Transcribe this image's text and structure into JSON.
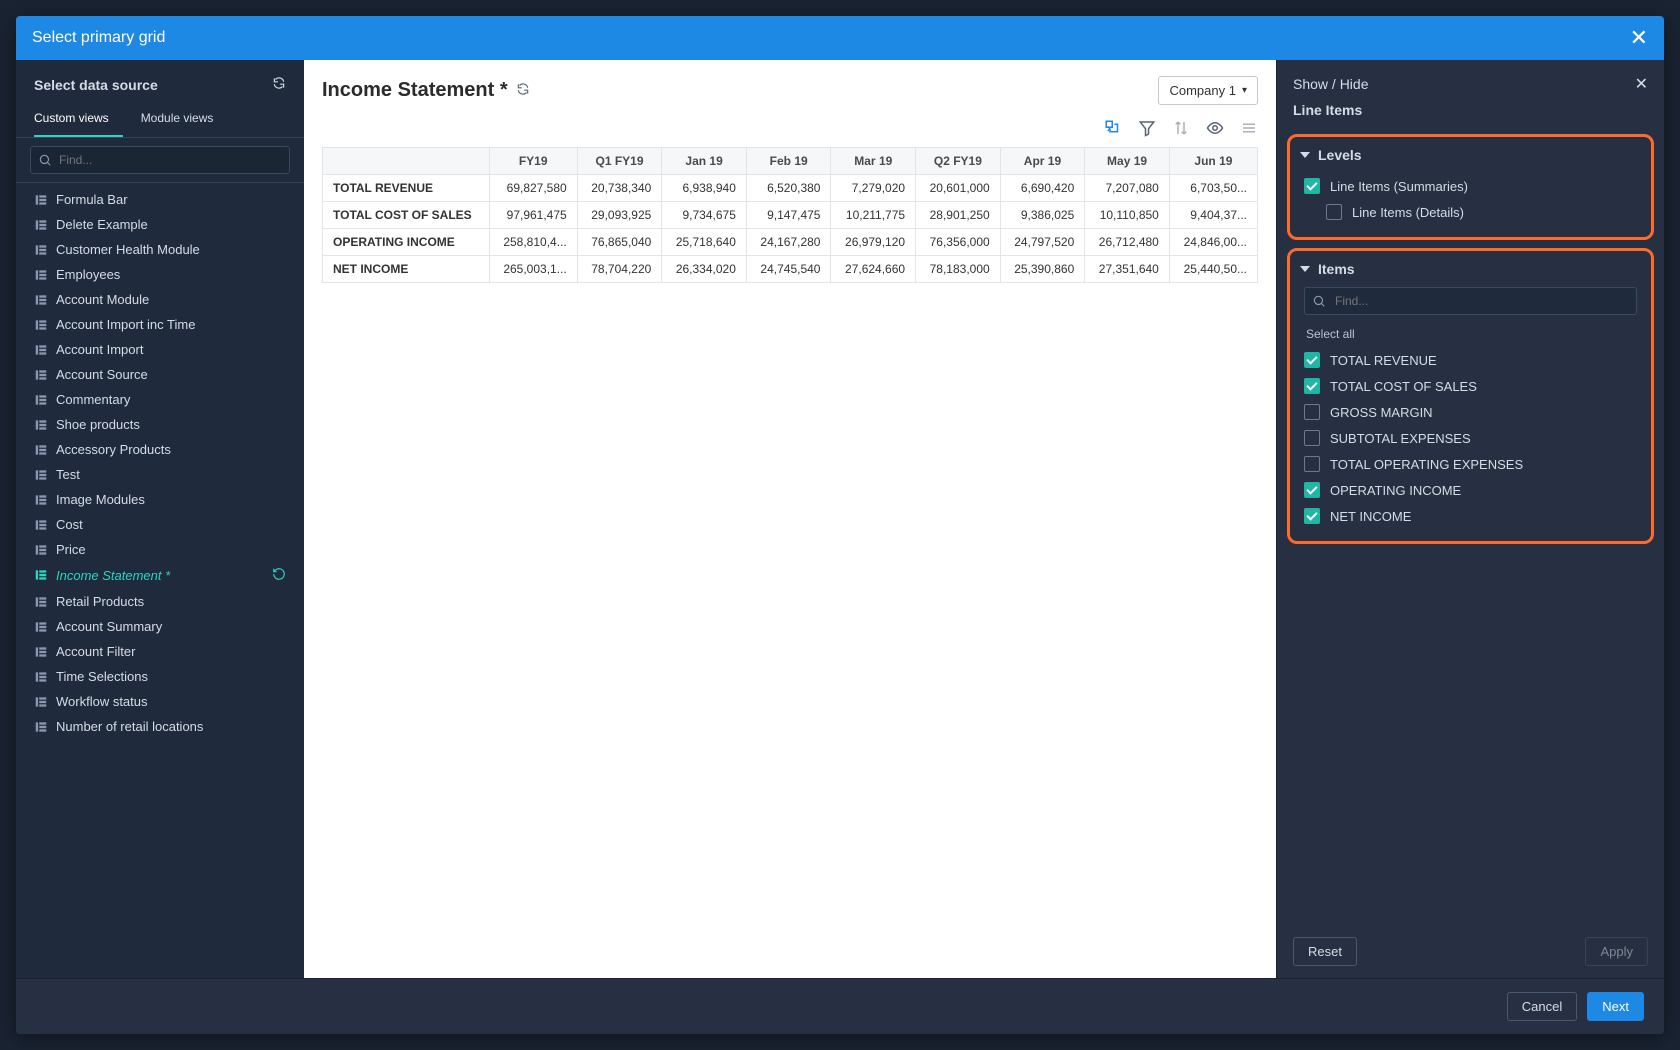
{
  "modal": {
    "title": "Select primary grid",
    "close": "✕"
  },
  "sidebar": {
    "header": "Select data source",
    "tabs": {
      "custom": "Custom views",
      "module": "Module views"
    },
    "search_placeholder": "Find...",
    "active_index": 15,
    "items": [
      "Formula Bar",
      "Delete Example",
      "Customer Health Module",
      "Employees",
      "Account Module",
      "Account Import inc Time",
      "Account Import",
      "Account Source",
      "Commentary",
      "Shoe products",
      "Accessory Products",
      "Test",
      "Image Modules",
      "Cost",
      "Price",
      "Income Statement *",
      "Retail Products",
      "Account Summary",
      "Account Filter",
      "Time Selections",
      "Workflow status",
      "Number of retail locations"
    ]
  },
  "center": {
    "title": "Income Statement *",
    "company": "Company 1",
    "columns": [
      "FY19",
      "Q1 FY19",
      "Jan 19",
      "Feb 19",
      "Mar 19",
      "Q2 FY19",
      "Apr 19",
      "May 19",
      "Jun 19"
    ],
    "rows": [
      {
        "label": "TOTAL REVENUE",
        "cells": [
          "69,827,580",
          "20,738,340",
          "6,938,940",
          "6,520,380",
          "7,279,020",
          "20,601,000",
          "6,690,420",
          "7,207,080",
          "6,703,50..."
        ]
      },
      {
        "label": "TOTAL COST OF SALES",
        "cells": [
          "97,961,475",
          "29,093,925",
          "9,734,675",
          "9,147,475",
          "10,211,775",
          "28,901,250",
          "9,386,025",
          "10,110,850",
          "9,404,37..."
        ]
      },
      {
        "label": "OPERATING INCOME",
        "cells": [
          "258,810,4...",
          "76,865,040",
          "25,718,640",
          "24,167,280",
          "26,979,120",
          "76,356,000",
          "24,797,520",
          "26,712,480",
          "24,846,00..."
        ]
      },
      {
        "label": "NET INCOME",
        "cells": [
          "265,003,1...",
          "78,704,220",
          "26,334,020",
          "24,745,540",
          "27,624,660",
          "78,183,000",
          "25,390,860",
          "27,351,640",
          "25,440,50..."
        ]
      }
    ]
  },
  "rpanel": {
    "show_hide": "Show / Hide",
    "line_items": "Line Items",
    "levels_label": "Levels",
    "levels": [
      {
        "label": "Line Items (Summaries)",
        "checked": true,
        "indent": false
      },
      {
        "label": "Line Items (Details)",
        "checked": false,
        "indent": true
      }
    ],
    "items_label": "Items",
    "items_placeholder": "Find...",
    "select_all": "Select all",
    "items": [
      {
        "label": "TOTAL REVENUE",
        "checked": true
      },
      {
        "label": "TOTAL COST OF SALES",
        "checked": true
      },
      {
        "label": "GROSS MARGIN",
        "checked": false
      },
      {
        "label": "SUBTOTAL EXPENSES",
        "checked": false
      },
      {
        "label": "TOTAL OPERATING EXPENSES",
        "checked": false
      },
      {
        "label": "OPERATING INCOME",
        "checked": true
      },
      {
        "label": "NET INCOME",
        "checked": true
      }
    ],
    "reset": "Reset",
    "apply": "Apply"
  },
  "footer": {
    "cancel": "Cancel",
    "next": "Next"
  }
}
